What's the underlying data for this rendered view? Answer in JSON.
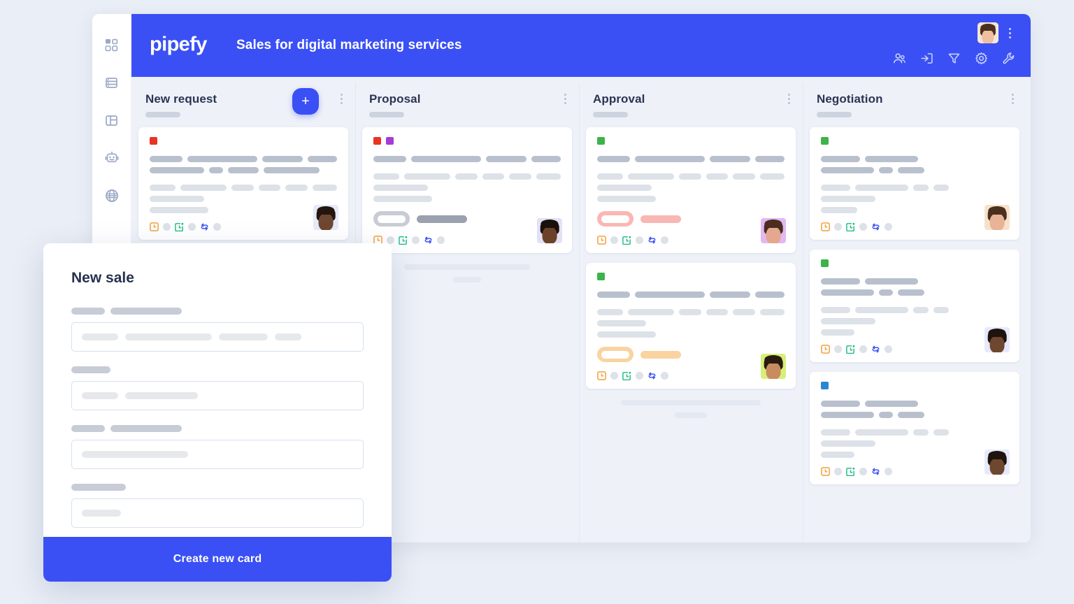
{
  "app": {
    "logo_text": "pipefy",
    "board_title": "Sales for digital marketing services",
    "accent_color": "#3a50f5",
    "canvas_bg": "#eaeef6",
    "board_bg": "#eef1f8"
  },
  "sidebar": {
    "items": [
      {
        "name": "dashboard-icon",
        "label": "Dashboard"
      },
      {
        "name": "database-icon",
        "label": "Database"
      },
      {
        "name": "layout-icon",
        "label": "Layout"
      },
      {
        "name": "automation-robot-icon",
        "label": "Automations"
      },
      {
        "name": "globe-icon",
        "label": "Portal"
      }
    ]
  },
  "topbar": {
    "actions": [
      {
        "name": "members-icon",
        "label": "Members"
      },
      {
        "name": "import-icon",
        "label": "Import"
      },
      {
        "name": "filter-icon",
        "label": "Filter"
      },
      {
        "name": "settings-gear-icon",
        "label": "Settings"
      },
      {
        "name": "wrench-icon",
        "label": "Tools"
      }
    ],
    "avatar_label": "User avatar",
    "kebab_label": "More options"
  },
  "board": {
    "add_button_label": "+",
    "columns": [
      {
        "title": "New request",
        "has_add_button": true,
        "cards": [
          {
            "tags": [
              "#ea3323"
            ],
            "lines": [
              {
                "tone": "dark",
                "widths": [
                  56,
                  120,
                  70,
                  50
                ]
              },
              {
                "tone": "dark",
                "widths": [
                  78,
                  20,
                  44,
                  80
                ]
              },
              {
                "tone": "gap"
              },
              {
                "tone": "light",
                "widths": [
                  42,
                  76,
                  36,
                  36,
                  36,
                  40
                ]
              },
              {
                "tone": "light",
                "widths": [
                  78
                ]
              },
              {
                "tone": "light",
                "widths": [
                  84
                ]
              }
            ],
            "pill": null,
            "avatar": {
              "skin": "#6e4730",
              "hair": "#23160f",
              "bg": "#e7e9fb"
            }
          }
        ],
        "ghost_bars": []
      },
      {
        "title": "Proposal",
        "has_add_button": false,
        "cards": [
          {
            "tags": [
              "#ea3323",
              "#a63ad6"
            ],
            "lines": [
              {
                "tone": "dark",
                "widths": [
                  56,
                  120,
                  70,
                  50
                ]
              },
              {
                "tone": "gap"
              },
              {
                "tone": "light",
                "widths": [
                  42,
                  76,
                  36,
                  36,
                  36,
                  40
                ]
              },
              {
                "tone": "light",
                "widths": [
                  78
                ]
              },
              {
                "tone": "light",
                "widths": [
                  84
                ]
              }
            ],
            "pill": {
              "style": "grey",
              "inner": 40,
              "bar": 72
            },
            "avatar": {
              "skin": "#6b4229",
              "hair": "#1a110c",
              "bg": "#e2e1f6"
            }
          }
        ],
        "ghost_bars": [
          180,
          40
        ]
      },
      {
        "title": "Approval",
        "has_add_button": false,
        "cards": [
          {
            "tags": [
              "#3cb34b"
            ],
            "lines": [
              {
                "tone": "dark",
                "widths": [
                  56,
                  120,
                  70,
                  50
                ]
              },
              {
                "tone": "gap"
              },
              {
                "tone": "light",
                "widths": [
                  42,
                  76,
                  36,
                  36,
                  36,
                  40
                ]
              },
              {
                "tone": "light",
                "widths": [
                  78
                ]
              },
              {
                "tone": "light",
                "widths": [
                  84
                ]
              }
            ],
            "pill": {
              "style": "red",
              "inner": 40,
              "bar": 58
            },
            "avatar": {
              "skin": "#e3a88f",
              "hair": "#4a2d1f",
              "bg": "#e3b7f0"
            }
          },
          {
            "tags": [
              "#3cb34b"
            ],
            "lines": [
              {
                "tone": "dark",
                "widths": [
                  56,
                  120,
                  70,
                  50
                ]
              },
              {
                "tone": "gap"
              },
              {
                "tone": "light",
                "widths": [
                  42,
                  76,
                  36,
                  36,
                  36,
                  40
                ]
              },
              {
                "tone": "light",
                "widths": [
                  70
                ]
              },
              {
                "tone": "light",
                "widths": [
                  84
                ]
              }
            ],
            "pill": {
              "style": "orange",
              "inner": 40,
              "bar": 58
            },
            "avatar": {
              "skin": "#c98c5e",
              "hair": "#2a1b10",
              "bg": "#d6f07a"
            }
          }
        ],
        "ghost_bars": [
          200,
          46
        ]
      },
      {
        "title": "Negotiation",
        "has_add_button": false,
        "cards": [
          {
            "tags": [
              "#3cb34b"
            ],
            "lines": [
              {
                "tone": "dark",
                "widths": [
                  56,
                  76
                ]
              },
              {
                "tone": "dark",
                "widths": [
                  76,
                  20,
                  38
                ]
              },
              {
                "tone": "gap"
              },
              {
                "tone": "light",
                "widths": [
                  42,
                  76,
                  22,
                  22
                ]
              },
              {
                "tone": "light",
                "widths": [
                  78
                ]
              },
              {
                "tone": "light",
                "widths": [
                  52
                ]
              }
            ],
            "pill": null,
            "avatar": {
              "skin": "#e8b396",
              "hair": "#4b3020",
              "bg": "#f7e2c9"
            }
          },
          {
            "tags": [
              "#3cb34b"
            ],
            "lines": [
              {
                "tone": "dark",
                "widths": [
                  56,
                  76
                ]
              },
              {
                "tone": "dark",
                "widths": [
                  76,
                  20,
                  38
                ]
              },
              {
                "tone": "gap"
              },
              {
                "tone": "light",
                "widths": [
                  42,
                  76,
                  22,
                  22
                ]
              },
              {
                "tone": "light",
                "widths": [
                  78
                ]
              },
              {
                "tone": "light",
                "widths": [
                  48
                ]
              }
            ],
            "pill": null,
            "avatar": {
              "skin": "#6e4730",
              "hair": "#1e130d",
              "bg": "#e7e9fb"
            }
          },
          {
            "tags": [
              "#2a87d0"
            ],
            "lines": [
              {
                "tone": "dark",
                "widths": [
                  56,
                  76
                ]
              },
              {
                "tone": "dark",
                "widths": [
                  76,
                  20,
                  38
                ]
              },
              {
                "tone": "gap"
              },
              {
                "tone": "light",
                "widths": [
                  42,
                  76,
                  22,
                  22
                ]
              },
              {
                "tone": "light",
                "widths": [
                  78
                ]
              },
              {
                "tone": "light",
                "widths": [
                  48
                ]
              }
            ],
            "pill": null,
            "avatar": {
              "skin": "#6e4730",
              "hair": "#1e130d",
              "bg": "#e7e9fb"
            }
          }
        ],
        "ghost_bars": []
      }
    ],
    "card_footer_icons": [
      {
        "name": "due-date-clock-icon",
        "color": "#f2962d"
      },
      {
        "name": "checklist-calendar-icon",
        "color": "#16b97f"
      },
      {
        "name": "connected-cards-icon",
        "color": "#3a50f5"
      }
    ]
  },
  "modal": {
    "title": "New sale",
    "cta_label": "Create new card",
    "fields": [
      {
        "label_widths": [
          48,
          102
        ],
        "value_widths": [
          52,
          124,
          70,
          38
        ]
      },
      {
        "label_widths": [
          56
        ],
        "value_widths": [
          52,
          104
        ]
      },
      {
        "label_widths": [
          48,
          102
        ],
        "value_widths": [
          152
        ]
      },
      {
        "label_widths": [
          78
        ],
        "value_widths": [
          56
        ]
      }
    ]
  }
}
